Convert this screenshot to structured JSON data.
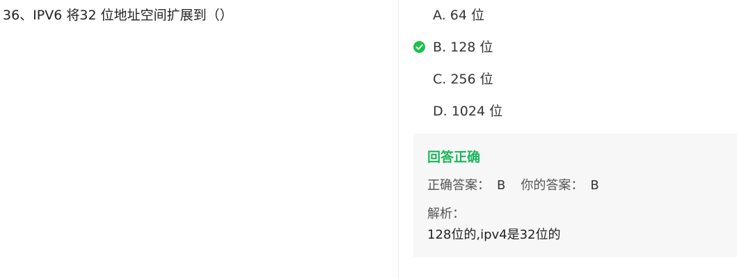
{
  "question": {
    "text": "36、IPV6 将32 位地址空间扩展到（）"
  },
  "options": [
    {
      "label": "A. 64 位",
      "selected": false
    },
    {
      "label": "B. 128 位",
      "selected": true,
      "icon": "check-circle-icon"
    },
    {
      "label": "C. 256 位",
      "selected": false
    },
    {
      "label": "D. 1024 位",
      "selected": false
    }
  ],
  "result": {
    "title": "回答正确",
    "correct_answer_label": "正确答案：",
    "correct_answer_value": "B",
    "your_answer_label": "你的答案：",
    "your_answer_value": "B",
    "analysis_label": "解析：",
    "analysis_text": "128位的,ipv4是32位的"
  },
  "colors": {
    "correct_green": "#1bb55c",
    "check_green": "#19c34a",
    "result_bg": "#f7f7f7"
  }
}
